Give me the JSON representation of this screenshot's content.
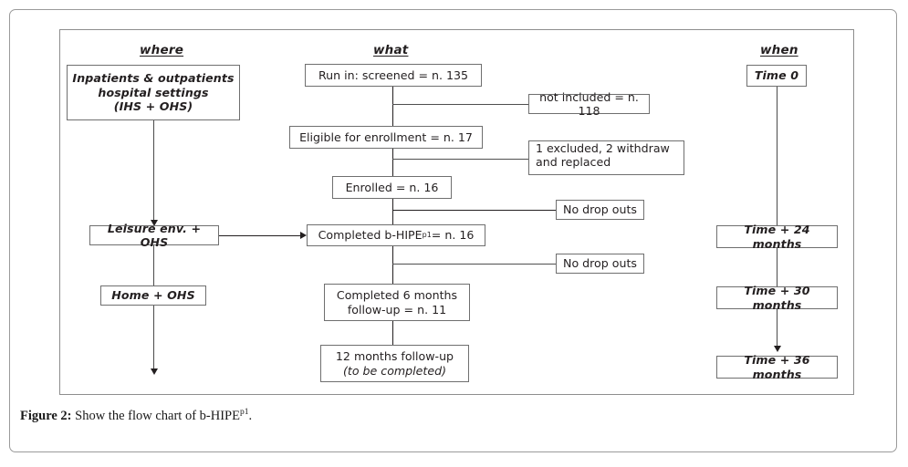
{
  "figure": {
    "caption_label": "Figure 2:",
    "caption_text": " Show the flow chart of b-HIPE",
    "caption_sup": "p1",
    "caption_end": "."
  },
  "columns": {
    "where": {
      "heading": "where"
    },
    "what": {
      "heading": "what"
    },
    "when": {
      "heading": "when"
    }
  },
  "where_nodes": [
    {
      "id": "inpatients",
      "line1": "Inpatients & outpatients",
      "line2": "hospital settings",
      "line3": "(IHS + OHS)"
    },
    {
      "id": "leisure",
      "label": "Leisure env. + OHS"
    },
    {
      "id": "home",
      "label": "Home + OHS"
    }
  ],
  "what_nodes": [
    {
      "id": "run-in",
      "label": "Run in: screened = n. 135"
    },
    {
      "id": "eligible",
      "label": "Eligible for enrollment = n. 17"
    },
    {
      "id": "enrolled",
      "label": "Enrolled = n. 16"
    },
    {
      "id": "completed-bhipe",
      "pre": "Completed b-HIPE",
      "sup": "p1",
      "post": " = n. 16"
    },
    {
      "id": "completed-6m",
      "line1": "Completed 6 months",
      "line2": "follow-up = n. 11"
    },
    {
      "id": "followup-12m",
      "line1": "12 months follow-up",
      "line2": "(to be completed)"
    }
  ],
  "side_nodes": [
    {
      "id": "not-included",
      "label": "not included = n. 118"
    },
    {
      "id": "excluded-withdraw",
      "line1": "1 excluded, 2 withdraw",
      "line2": "and replaced"
    },
    {
      "id": "no-drop-outs-1",
      "label": "No drop outs"
    },
    {
      "id": "no-drop-outs-2",
      "label": "No drop outs"
    }
  ],
  "when_nodes": [
    {
      "id": "time-0",
      "label": "Time 0"
    },
    {
      "id": "time-24",
      "label": "Time + 24 months"
    },
    {
      "id": "time-30",
      "label": "Time + 30 months"
    },
    {
      "id": "time-36",
      "label": "Time + 36 months"
    }
  ],
  "colors": {
    "box_border": "#6f6f6f",
    "frame_border": "#9a9a9a",
    "line": "#231f20",
    "text": "#231f20",
    "background": "#ffffff"
  }
}
